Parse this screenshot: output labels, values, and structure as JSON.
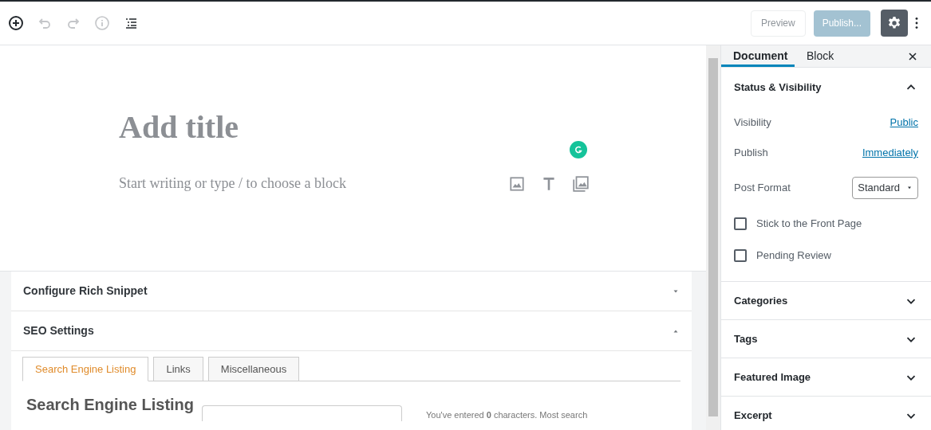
{
  "toolbar": {
    "undo_disabled": true,
    "redo_disabled": true,
    "info_disabled": true,
    "preview": "Preview",
    "publish": "Publish...",
    "publish_disabled": true,
    "settings_active": true
  },
  "editor": {
    "title_placeholder": "Add title",
    "block_placeholder": "Start writing or type / to choose a block"
  },
  "meta_boxes": [
    {
      "title": "Configure Rich Snippet",
      "expanded": false
    },
    {
      "title": "SEO Settings",
      "expanded": true
    }
  ],
  "seo": {
    "tabs": [
      {
        "label": "Search Engine Listing",
        "selected": true
      },
      {
        "label": "Links",
        "selected": false
      },
      {
        "label": "Miscellaneous",
        "selected": false
      }
    ],
    "heading": "Search Engine Listing",
    "note": "You've entered **0** characters. Most search"
  },
  "sidebar": {
    "tabs": [
      {
        "label": "Document",
        "selected": true
      },
      {
        "label": "Block",
        "selected": false
      }
    ],
    "status_title": "Status & Visibility",
    "status_expanded": true,
    "rows": [
      {
        "label": "Visibility",
        "value": "Public"
      },
      {
        "label": "Publish",
        "value": "Immediately"
      }
    ],
    "post_format": {
      "label": "Post Format",
      "value": "Standard"
    },
    "checkboxes": [
      {
        "label": "Stick to the Front Page",
        "checked": false
      },
      {
        "label": "Pending Review",
        "checked": false
      }
    ],
    "panels": [
      {
        "title": "Categories",
        "expanded": false
      },
      {
        "title": "Tags",
        "expanded": false
      },
      {
        "title": "Featured Image",
        "expanded": false
      },
      {
        "title": "Excerpt",
        "expanded": false
      }
    ]
  }
}
